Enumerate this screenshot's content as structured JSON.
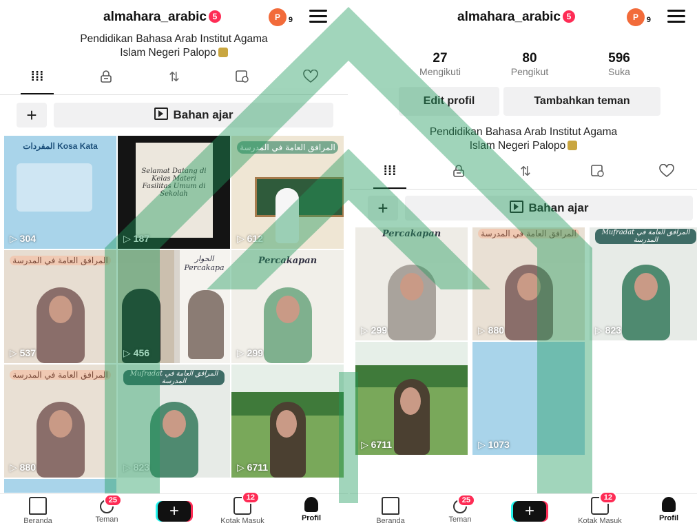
{
  "left": {
    "username": "almahara_arabic",
    "username_badge": "5",
    "avatar_letter": "P",
    "avatar_count": "9",
    "bio_line1": "Pendidikan Bahasa Arab Institut Agama",
    "bio_line2": "Islam Negeri Palopo",
    "playlist_label": "Bahan ajar",
    "plus": "+",
    "videos": [
      {
        "views": "304",
        "title": "المفردات Kosa Kata"
      },
      {
        "views": "187",
        "title": "Selamat Datang di Kelas Materi Fasilitas Umum di Sekolah"
      },
      {
        "views": "612",
        "title": "المرافق العامة في المدرسة"
      },
      {
        "views": "537",
        "title": "المرافق العامة في المدرسة"
      },
      {
        "views": "456",
        "title": "الحوار Percakapa"
      },
      {
        "views": "299",
        "title": "Percakapan"
      },
      {
        "views": "880",
        "title": "المرافق العامة في المدرسة"
      },
      {
        "views": "823",
        "title": "Mufradat المرافق العامة في المدرسة"
      },
      {
        "views": "6711",
        "title": ""
      }
    ]
  },
  "right": {
    "username": "almahara_arabic",
    "username_badge": "5",
    "avatar_letter": "P",
    "avatar_count": "9",
    "stats": [
      {
        "value": "27",
        "label": "Mengikuti"
      },
      {
        "value": "80",
        "label": "Pengikut"
      },
      {
        "value": "596",
        "label": "Suka"
      }
    ],
    "edit_profile": "Edit profil",
    "add_friend": "Tambahkan teman",
    "bio_line1": "Pendidikan Bahasa Arab Institut Agama",
    "bio_line2": "Islam Negeri Palopo",
    "playlist_label": "Bahan ajar",
    "plus": "+",
    "videos": [
      {
        "views": "299",
        "title": "Percakapan"
      },
      {
        "views": "880",
        "title": "المرافق العامة في المدرسة"
      },
      {
        "views": "823",
        "title": "Mufradat المرافق العامة في المدرسة"
      },
      {
        "views": "6711",
        "title": ""
      },
      {
        "views": "1073",
        "title": ""
      }
    ]
  },
  "nav": {
    "home": "Beranda",
    "friends": "Teman",
    "friends_badge": "25",
    "create": "+",
    "inbox": "Kotak Masuk",
    "inbox_badge": "12",
    "profile": "Profil"
  },
  "colors": {
    "accent_red": "#fe2c55",
    "accent_cyan": "#25f4ee",
    "watermark_green": "#1f9a5c"
  },
  "icons": {
    "tab_grid": "grid-icon",
    "tab_lock": "lock-icon",
    "tab_repost": "repost-icon",
    "tab_tagged": "tagged-icon",
    "tab_liked": "liked-icon"
  }
}
